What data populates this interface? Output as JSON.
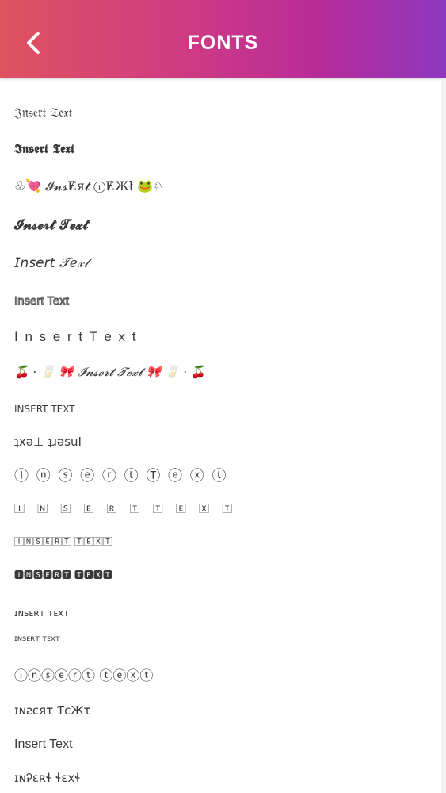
{
  "header": {
    "title": "FONTS",
    "back_icon": "chevron-left-icon",
    "gradient": [
      "#e0525e",
      "#b92c98",
      "#8e38bf"
    ]
  },
  "fonts": [
    "𝔍𝔫𝔰𝔢𝔯𝔱 𝔗𝔢𝔵𝔱",
    "𝕴𝖓𝖘𝖊𝖗𝖙 𝕿𝖊𝖝𝖙",
    "♧💘 𝓘𝓷𝓼Ɇя𝓽 ⓣɆЖł 🐸♘",
    "𝓘𝓷𝓼𝓮𝓻𝓽 𝓣𝓮𝔁𝓽",
    "𝘐𝘯𝘴𝘦𝘳𝘵 𝒯𝑒𝓍𝓉",
    "Insert Text",
    "I n s e r t   T e x t",
    "🍒 · 🥛 🎀 𝓘𝓷𝓼𝓮𝓻𝓽 𝓣𝓮𝔁𝓽 🎀 🥛 · 🍒",
    "INSERT TEXT",
    "ʇxǝ⊥ ʇɹǝsuI",
    "Ⓘ ⓝ ⓢ ⓔ ⓡ ⓣ Ⓣ ⓔ ⓧ ⓣ",
    "🄸 🄽 🅂 🄴 🅁 🅃 🅃 🄴 🅇 🅃",
    "🄸🄽🅂🄴🅁🅃 🅃🄴🅇🅃",
    "🅸🅽🆂🅴🆁🆃 🆃🅴🆇🆃",
    "ɪɴꜱᴇʀᴛ ᴛᴇxᴛ",
    "ɪɴsᴇʀᴛ ᴛᴇxᴛ",
    "ⓘⓝⓢⓔⓡⓣ ⓣⓔⓧⓣ",
    "ɪɴƨєяτ ƬєЖτ",
    "Inѕert Text",
    "ɪɴᎮɛʀɬ ɬɛxɬ"
  ]
}
